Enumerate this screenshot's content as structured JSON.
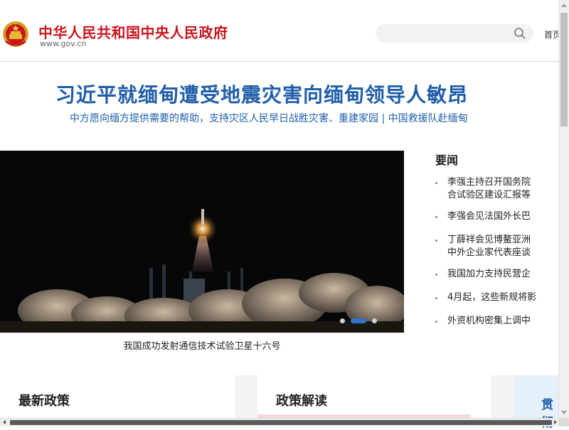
{
  "header": {
    "site_title": "中华人民共和国中央人民政府",
    "site_url": "www.gov.cn",
    "search": {
      "placeholder": "",
      "icon": "search-icon"
    },
    "nav_home_label": "首页"
  },
  "headline": {
    "title": "习近平就缅甸遭受地震灾害向缅甸领导人敏昂",
    "subtitle": "中方愿向缅方提供需要的帮助，支持灾区人民早日战胜灾害、重建家园 | 中国救援队赴缅甸"
  },
  "hero": {
    "caption": "我国成功发射通信技术试验卫星十六号",
    "slides_total": 3,
    "active_slide": 2
  },
  "news": {
    "title": "要闻",
    "items": [
      {
        "text": "李强主持召开国务院\n合试验区建设汇报等"
      },
      {
        "text": "李强会见法国外长巴"
      },
      {
        "text": "丁薛祥会见博鳌亚洲\n中外企业家代表座谈"
      },
      {
        "text": "我国加力支持民营企"
      },
      {
        "text": "4月起，这些新规将影"
      },
      {
        "text": "外资机构密集上调中"
      }
    ]
  },
  "panels": {
    "latest_policy": "最新政策",
    "policy_interpretation": "政策解读",
    "third_partial": "贯彻"
  },
  "colors": {
    "brand_red": "#c8161e",
    "headline_blue": "#1f5ea8",
    "carousel_active": "#2f74c8"
  }
}
